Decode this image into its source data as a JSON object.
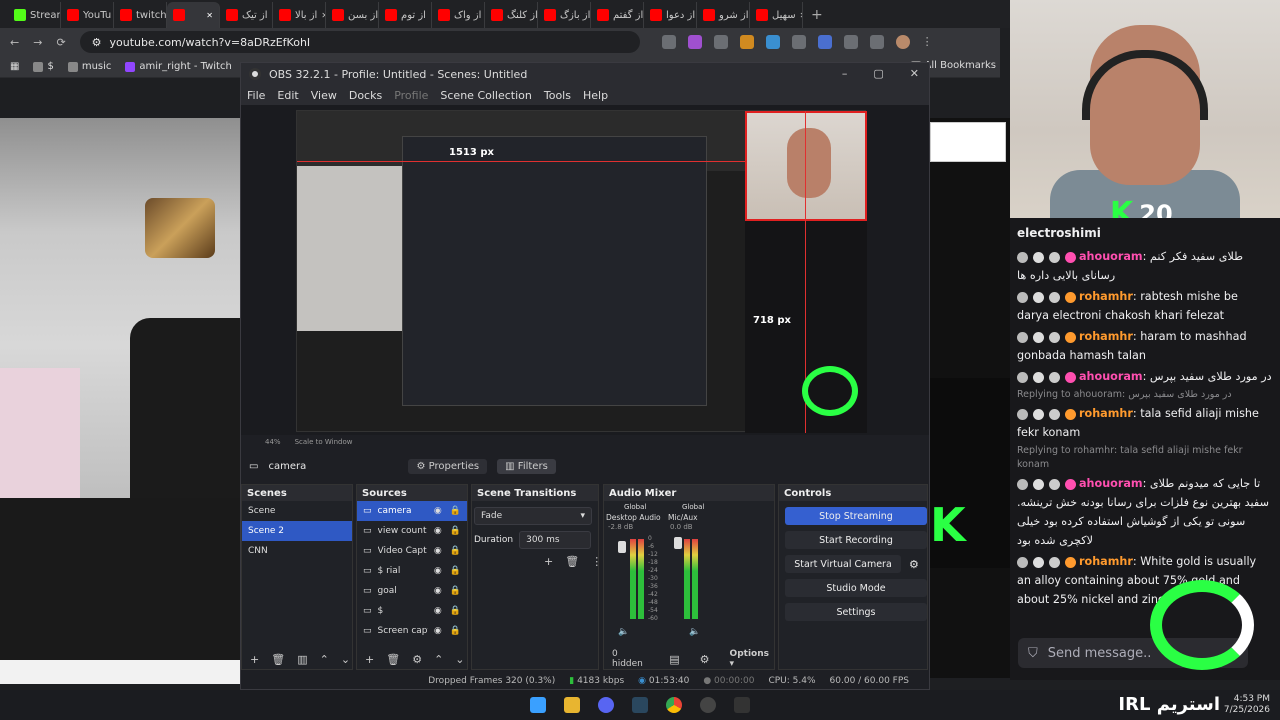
{
  "browser": {
    "tabs": [
      {
        "label": "Stream",
        "color": "#53fc18",
        "active": false
      },
      {
        "label": "YouTu",
        "color": "#ff0000",
        "active": false
      },
      {
        "label": "twitch",
        "color": "#ff0000",
        "active": false
      },
      {
        "label": "",
        "color": "#ff0000",
        "active": true
      },
      {
        "label": "از تیک",
        "color": "#ff0000",
        "active": false
      },
      {
        "label": "از بالا",
        "color": "#ff0000",
        "active": false
      },
      {
        "label": "از بسن",
        "color": "#ff0000",
        "active": false
      },
      {
        "label": "از توم",
        "color": "#ff0000",
        "active": false
      },
      {
        "label": "از واک",
        "color": "#ff0000",
        "active": false
      },
      {
        "label": "از کلنگ",
        "color": "#ff0000",
        "active": false
      },
      {
        "label": "از بازگ",
        "color": "#ff0000",
        "active": false
      },
      {
        "label": "از گفتم",
        "color": "#ff0000",
        "active": false
      },
      {
        "label": "از دعوا",
        "color": "#ff0000",
        "active": false
      },
      {
        "label": "از شرو",
        "color": "#ff0000",
        "active": false
      },
      {
        "label": "سهیل",
        "color": "#ff0000",
        "active": false
      }
    ],
    "new_tab": "+",
    "url": "youtube.com/watch?v=8aDRzEfKohI",
    "bookmarks": [
      "$",
      "music",
      "amir_right - Twitch"
    ],
    "all_bookmarks": "All Bookmarks"
  },
  "obs": {
    "title": "OBS 32.2.1 - Profile: Untitled - Scenes: Untitled",
    "menu": [
      "File",
      "Edit",
      "View",
      "Docks",
      "Profile",
      "Scene Collection",
      "Tools",
      "Help"
    ],
    "preview_labels": {
      "width": "1513 px",
      "height": "718 px"
    },
    "preview_bar": {
      "zoom": "44%",
      "mode": "Scale to Window"
    },
    "selected_source": "camera",
    "properties_btn": "Properties",
    "filters_btn": "Filters",
    "scenes": {
      "title": "Scenes",
      "items": [
        {
          "label": "Scene",
          "selected": false
        },
        {
          "label": "Scene 2",
          "selected": true
        },
        {
          "label": "CNN",
          "selected": false
        }
      ]
    },
    "sources": {
      "title": "Sources",
      "items": [
        {
          "label": "camera",
          "selected": true
        },
        {
          "label": "view count",
          "selected": false
        },
        {
          "label": "Video Capt",
          "selected": false
        },
        {
          "label": "$ rial",
          "selected": false
        },
        {
          "label": "goal",
          "selected": false
        },
        {
          "label": "$",
          "selected": false
        },
        {
          "label": "Screen captu",
          "selected": false
        }
      ]
    },
    "transitions": {
      "title": "Scene Transitions",
      "type": "Fade",
      "duration_label": "Duration",
      "duration": "300 ms"
    },
    "mixer": {
      "title": "Audio Mixer",
      "channels": [
        {
          "label": "Desktop Audio",
          "tag": "Global",
          "db": "-2.8 dB",
          "level": 0.72
        },
        {
          "label": "Mic/Aux",
          "tag": "Global",
          "db": "0.0 dB",
          "level": 0.68
        }
      ],
      "scale": [
        "0",
        "-6",
        "-12",
        "-18",
        "-24",
        "-30",
        "-36",
        "-42",
        "-48",
        "-54",
        "-60"
      ],
      "hidden": "0 hidden",
      "options": "Options"
    },
    "controls": {
      "title": "Controls",
      "buttons": [
        "Stop Streaming",
        "Start Recording",
        "Start Virtual Camera",
        "Studio Mode",
        "Settings"
      ]
    },
    "status": {
      "dropped": "Dropped Frames 320 (0.3%)",
      "kbps": "4183 kbps",
      "stream_time": "01:53:40",
      "rec_time": "00:00:00",
      "cpu": "CPU: 5.4%",
      "fps": "60.00 / 60.00 FPS"
    }
  },
  "stream_overlay": {
    "view_count": "20",
    "chat_user": "electroshimi",
    "messages": [
      {
        "user": "ahouoram",
        "badge_color": "#ff4fb0",
        "text": "طلای سفید فکر کنم رسانای بالایی داره ها"
      },
      {
        "user": "rohamhr",
        "badge_color": "#ff9a2e",
        "text": "rabtesh mishe be darya electroni chakosh khari felezat"
      },
      {
        "user": "rohamhr",
        "badge_color": "#ff9a2e",
        "text": "haram to mashhad gonbada hamash talan"
      },
      {
        "user": "ahouoram",
        "badge_color": "#ff4fb0",
        "text": "در مورد طلای سفید بپرس"
      },
      {
        "reply": "Replying to ahouoram: در مورد طلای سفید بپرس"
      },
      {
        "user": "rohamhr",
        "badge_color": "#ff9a2e",
        "text": "tala sefid aliaji mishe fekr konam"
      },
      {
        "reply": "Replying to rohamhr: tala sefid aliaji mishe fekr konam"
      },
      {
        "user": "ahouoram",
        "badge_color": "#ff4fb0",
        "text": "تا جایی که میدونم طلای سفید بهترین نوع فلزات برای رسانا بودنه خش ترینشه. سونی تو یکی از گوشیاش استفاده کرده بود خیلی لاکچری شده بود"
      },
      {
        "user": "rohamhr",
        "badge_color": "#ff9a2e",
        "text": "White gold is usually an alloy containing about 75% gold and about 25% nickel and zinc"
      }
    ],
    "send_placeholder": "Send message..",
    "irl_text": "IRL استریم"
  },
  "taskbar": {
    "tray_time": "4:53 PM",
    "tray_date": "7/25/2026"
  },
  "colors": {
    "accent": "#2f59c4",
    "kick_green": "#2aff44"
  }
}
